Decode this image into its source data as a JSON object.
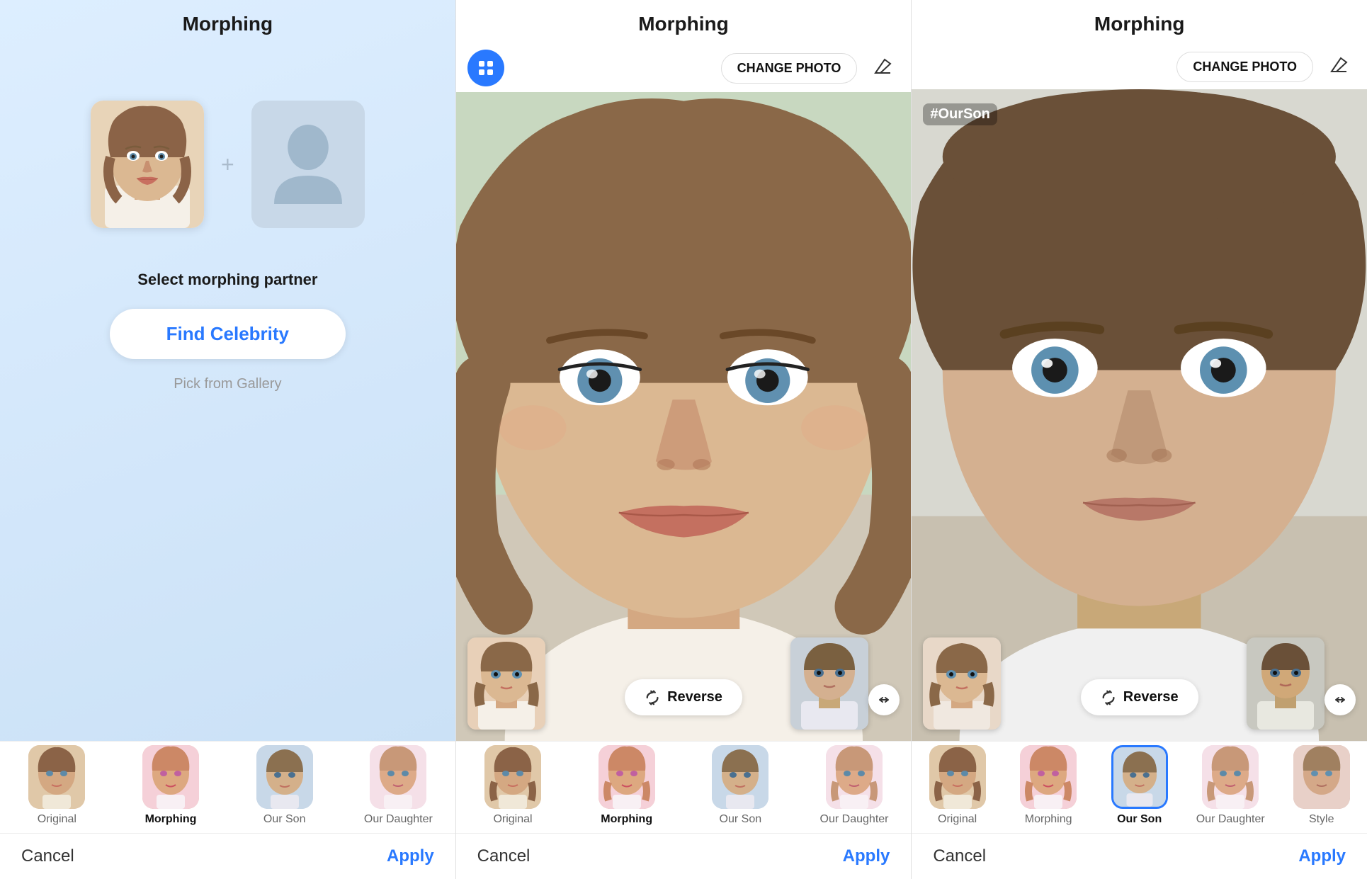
{
  "panel1": {
    "title": "Morphing",
    "select_label": "Select morphing partner",
    "find_celebrity_label": "Find Celebrity",
    "pick_gallery_label": "Pick from Gallery",
    "cancel_label": "Cancel",
    "apply_label": "Apply",
    "tabs": [
      {
        "label": "Original",
        "style": "original"
      },
      {
        "label": "Morphing",
        "style": "morph",
        "bold": true
      },
      {
        "label": "Our Son",
        "style": "son"
      },
      {
        "label": "Our Daughter",
        "style": "daughter"
      }
    ]
  },
  "panel2": {
    "title": "Morphing",
    "change_photo_label": "CHANGE PHOTO",
    "reverse_label": "Reverse",
    "cancel_label": "Cancel",
    "apply_label": "Apply",
    "tabs": [
      {
        "label": "Original",
        "style": "original"
      },
      {
        "label": "Morphing",
        "style": "morph",
        "bold": true
      },
      {
        "label": "Our Son",
        "style": "son"
      },
      {
        "label": "Our Daughter",
        "style": "daughter"
      }
    ]
  },
  "panel3": {
    "title": "Morphing",
    "change_photo_label": "CHANGE PHOTO",
    "reverse_label": "Reverse",
    "hashtag": "#OurSon",
    "cancel_label": "Cancel",
    "apply_label": "Apply",
    "tabs": [
      {
        "label": "Original",
        "style": "original"
      },
      {
        "label": "Morphing",
        "style": "morph"
      },
      {
        "label": "Our Son",
        "style": "son",
        "bold": true
      },
      {
        "label": "Our Daughter",
        "style": "daughter"
      },
      {
        "label": "Style",
        "style": "style"
      }
    ]
  },
  "icons": {
    "grid": "⊞",
    "eraser": "◇",
    "reverse": "↺",
    "expand": "⟺"
  }
}
